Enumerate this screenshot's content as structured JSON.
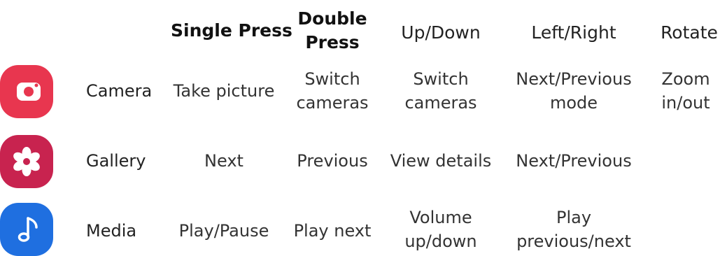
{
  "headers": {
    "single": "Single Press",
    "double_line1": "Double",
    "double_line2": "Press",
    "updown": "Up/Down",
    "leftright": "Left/Right",
    "rotate": "Rotate"
  },
  "rows": [
    {
      "app": "Camera",
      "icon": "camera-icon",
      "icon_color": "#e8364f",
      "single": [
        "Take picture"
      ],
      "double": [
        "Switch",
        "cameras"
      ],
      "updown": [
        "Switch",
        "cameras"
      ],
      "leftright": [
        "Next/Previous",
        "mode"
      ],
      "rotate": [
        "Zoom",
        "in/out"
      ]
    },
    {
      "app": "Gallery",
      "icon": "flower-icon",
      "icon_color": "#c8234f",
      "single": [
        "Next"
      ],
      "double": [
        "Previous"
      ],
      "updown": [
        "View details"
      ],
      "leftright": [
        "Next/Previous"
      ],
      "rotate": []
    },
    {
      "app": "Media",
      "icon": "music-note-icon",
      "icon_color": "#1f6fe0",
      "single": [
        "Play/Pause"
      ],
      "double": [
        "Play next"
      ],
      "updown": [
        "Volume",
        "up/down"
      ],
      "leftright": [
        "Play",
        "previous/next"
      ],
      "rotate": []
    }
  ]
}
